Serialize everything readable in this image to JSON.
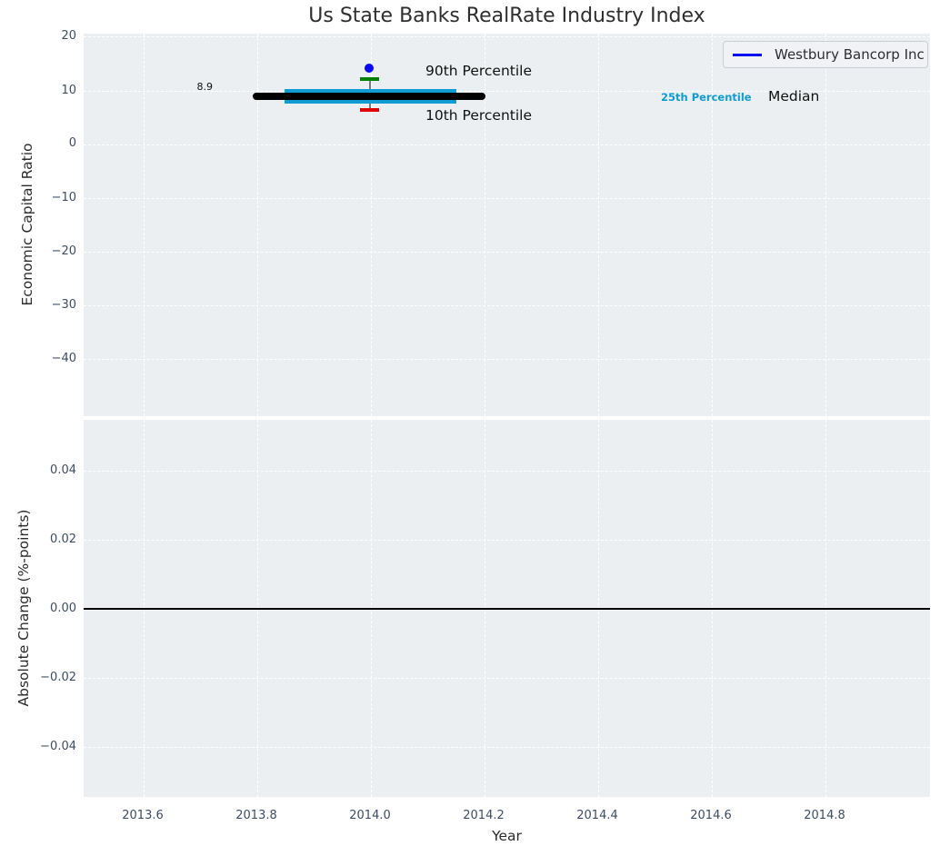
{
  "title": "Us State Banks RealRate Industry Index",
  "legend": {
    "label": "Westbury Bancorp Inc"
  },
  "top_plot": {
    "ylabel": "Economic Capital Ratio",
    "yticks": [
      "20",
      "10",
      "0",
      "−10",
      "−20",
      "−30",
      "−40"
    ],
    "annotations": {
      "median_value": "8.9",
      "p90": "90th Percentile",
      "p10": "10th Percentile",
      "p25": "25th Percentile",
      "median": "Median"
    }
  },
  "bottom_plot": {
    "ylabel": "Absolute Change (%-points)",
    "yticks": [
      "0.04",
      "0.02",
      "0.00",
      "−0.02",
      "−0.04"
    ]
  },
  "x_axis": {
    "label": "Year",
    "ticks": [
      "2013.6",
      "2013.8",
      "2014.0",
      "2014.2",
      "2014.4",
      "2014.6",
      "2014.8"
    ]
  },
  "colors": {
    "plot_background": "#eceff1",
    "grid": "#ffffff",
    "tick_label": "#3d4c63",
    "median_line": "#000000",
    "percentile_25_line": "#109bd2",
    "percentile_90_cap": "#008000",
    "percentile_10_cap": "#e10000",
    "company_marker": "#0a0af0",
    "errorbar_stem": "#7a7a7a",
    "zero_line": "#000000"
  },
  "chart_data": {
    "type": "line",
    "title": "Us State Banks RealRate Industry Index",
    "xlabel": "Year",
    "xlim": [
      2013.5,
      2014.99
    ],
    "xticks": [
      2013.6,
      2013.8,
      2014.0,
      2014.2,
      2014.4,
      2014.6,
      2014.8
    ],
    "grid": true,
    "legend": {
      "entries": [
        "Westbury Bancorp Inc"
      ],
      "position": "upper right"
    },
    "subplots": [
      {
        "ylabel": "Economic Capital Ratio",
        "ylim": [
          -50.5,
          20.5
        ],
        "yticks": [
          20,
          10,
          0,
          -10,
          -20,
          -30,
          -40
        ],
        "series": [
          {
            "name": "Median",
            "type": "line",
            "color": "#000000",
            "style": "thick",
            "x": [
              2013.8,
              2014.2
            ],
            "y": [
              8.9,
              8.9
            ],
            "value_label": "8.9",
            "text_label": "Median"
          },
          {
            "name": "25th Percentile",
            "type": "line",
            "color": "#109bd2",
            "style": "extra-thick",
            "x": [
              2013.85,
              2014.15
            ],
            "y": [
              8.8,
              8.8
            ],
            "text_label": "25th Percentile"
          },
          {
            "name": "Westbury Bancorp Inc",
            "type": "scatter",
            "color": "#0a0af0",
            "x": [
              2014.0
            ],
            "y": [
              14.1
            ]
          },
          {
            "name": "90th Percentile",
            "type": "errorbar_cap",
            "color": "#008000",
            "x": [
              2014.0
            ],
            "y": [
              12.1
            ],
            "text_label": "90th Percentile"
          },
          {
            "name": "10th Percentile",
            "type": "errorbar_cap",
            "color": "#e10000",
            "x": [
              2014.0
            ],
            "y": [
              6.4
            ],
            "text_label": "10th Percentile"
          }
        ]
      },
      {
        "ylabel": "Absolute Change (%-points)",
        "ylim": [
          -0.055,
          0.055
        ],
        "yticks": [
          0.04,
          0.02,
          0.0,
          -0.02,
          -0.04
        ],
        "series": [
          {
            "name": "zero line",
            "type": "hline",
            "color": "#000000",
            "y": 0.0
          }
        ]
      }
    ]
  }
}
